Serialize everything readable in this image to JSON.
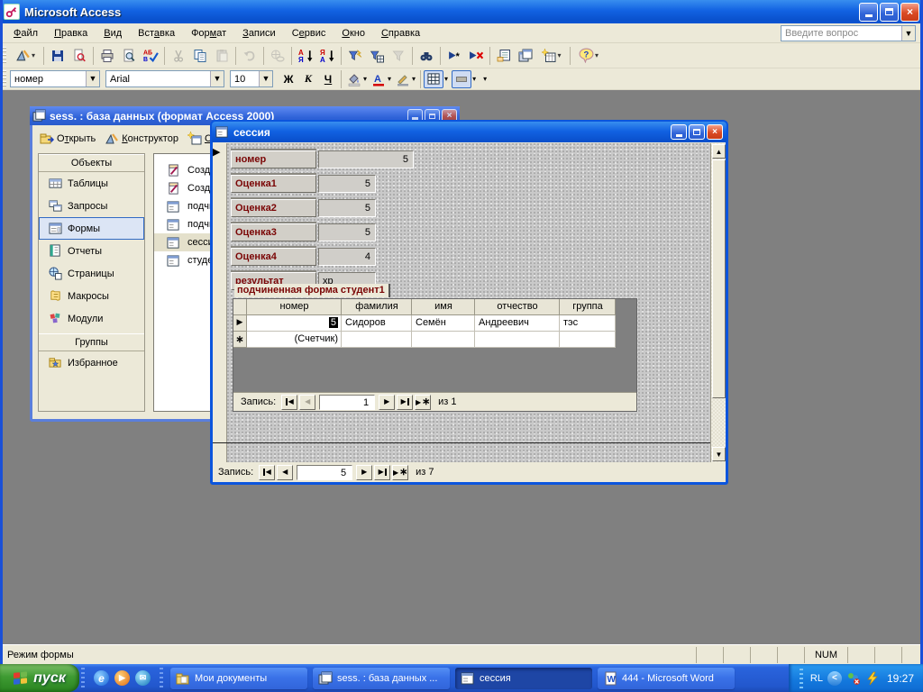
{
  "app": {
    "title": "Microsoft Access"
  },
  "menu": {
    "items": [
      {
        "label": "Файл",
        "accel": 0
      },
      {
        "label": "Правка",
        "accel": 0
      },
      {
        "label": "Вид",
        "accel": 0
      },
      {
        "label": "Вставка",
        "accel": 3
      },
      {
        "label": "Формат",
        "accel": 3
      },
      {
        "label": "Записи",
        "accel": 0
      },
      {
        "label": "Сервис",
        "accel": 1
      },
      {
        "label": "Окно",
        "accel": 0
      },
      {
        "label": "Справка",
        "accel": 0
      }
    ],
    "question_placeholder": "Введите вопрос"
  },
  "toolbar_main": {
    "buttons": [
      {
        "name": "view-design",
        "dropdown": true
      },
      {
        "sep": true
      },
      {
        "name": "save"
      },
      {
        "name": "file-search"
      },
      {
        "sep": true
      },
      {
        "name": "print"
      },
      {
        "name": "print-preview"
      },
      {
        "name": "spelling"
      },
      {
        "sep": true
      },
      {
        "name": "cut",
        "disabled": true
      },
      {
        "name": "copy"
      },
      {
        "name": "paste",
        "disabled": true
      },
      {
        "sep": true
      },
      {
        "name": "undo",
        "disabled": true
      },
      {
        "sep": true
      },
      {
        "name": "hyperlink",
        "disabled": true
      },
      {
        "sep": true
      },
      {
        "name": "sort-ascending"
      },
      {
        "name": "sort-descending"
      },
      {
        "sep": true
      },
      {
        "name": "filter-by-selection"
      },
      {
        "name": "filter-by-form"
      },
      {
        "name": "apply-filter",
        "disabled": true
      },
      {
        "sep": true
      },
      {
        "name": "find"
      },
      {
        "sep": true
      },
      {
        "name": "new-record"
      },
      {
        "name": "delete-record"
      },
      {
        "sep": true
      },
      {
        "name": "properties"
      },
      {
        "name": "database-window"
      },
      {
        "name": "new-object",
        "dropdown": true
      },
      {
        "sep": true
      },
      {
        "name": "help",
        "dropdown": true
      }
    ]
  },
  "toolbar_format": {
    "control_name": "номер",
    "font_name": "Arial",
    "font_size": "10",
    "bold_label": "Ж",
    "italic_label": "К",
    "underline_label": "Ч"
  },
  "db_window": {
    "title": "sess. : база данных (формат Access 2000)",
    "buttons": [
      {
        "label": "Открыть",
        "accel": 1
      },
      {
        "label": "Конструктор",
        "accel": 0
      },
      {
        "label": "Создать",
        "accel": 0
      }
    ],
    "objects_header": "Объекты",
    "objects": [
      {
        "label": "Таблицы"
      },
      {
        "label": "Запросы"
      },
      {
        "label": "Формы"
      },
      {
        "label": "Отчеты"
      },
      {
        "label": "Страницы"
      },
      {
        "label": "Макросы"
      },
      {
        "label": "Модули"
      }
    ],
    "groups_header": "Группы",
    "groups": [
      {
        "label": "Избранное"
      }
    ],
    "items": [
      {
        "label": "Создан"
      },
      {
        "label": "Создан"
      },
      {
        "label": "подчин"
      },
      {
        "label": "подчин"
      },
      {
        "label": "сессия"
      },
      {
        "label": "студент"
      }
    ]
  },
  "form_window": {
    "title": "сессия",
    "fields": [
      {
        "label": "номер",
        "value": "5"
      },
      {
        "label": "Оценка1",
        "value": "5"
      },
      {
        "label": "Оценка2",
        "value": "5"
      },
      {
        "label": "Оценка3",
        "value": "5"
      },
      {
        "label": "Оценка4",
        "value": "4"
      },
      {
        "label": "результат",
        "value": "хр"
      }
    ],
    "subform": {
      "label": "подчиненная форма студент1",
      "columns": [
        "номер",
        "фамилия",
        "имя",
        "отчество",
        "группа"
      ],
      "row1": {
        "nomer": "5",
        "familiya": "Сидоров",
        "imya": "Семён",
        "otchestvo": "Андреевич",
        "gruppa": "тэс"
      },
      "new_row_nomer": "(Счетчик)",
      "nav": {
        "label": "Запись:",
        "current": "1",
        "of": "из 1"
      }
    },
    "nav": {
      "label": "Запись:",
      "current": "5",
      "of": "из 7"
    }
  },
  "status_bar": {
    "mode": "Режим формы",
    "num": "NUM"
  },
  "taskbar": {
    "start_label": "пуск",
    "buttons": [
      {
        "label": "Мои документы"
      },
      {
        "label": "sess. : база данных ..."
      },
      {
        "label": "сессия"
      },
      {
        "label": "444 - Microsoft Word"
      }
    ],
    "tray": {
      "lang": "RL",
      "time": "19:27"
    }
  },
  "colors": {
    "title_blue": "#1262e2",
    "label_maroon": "#7a0505",
    "mdi_gray": "#808080"
  }
}
